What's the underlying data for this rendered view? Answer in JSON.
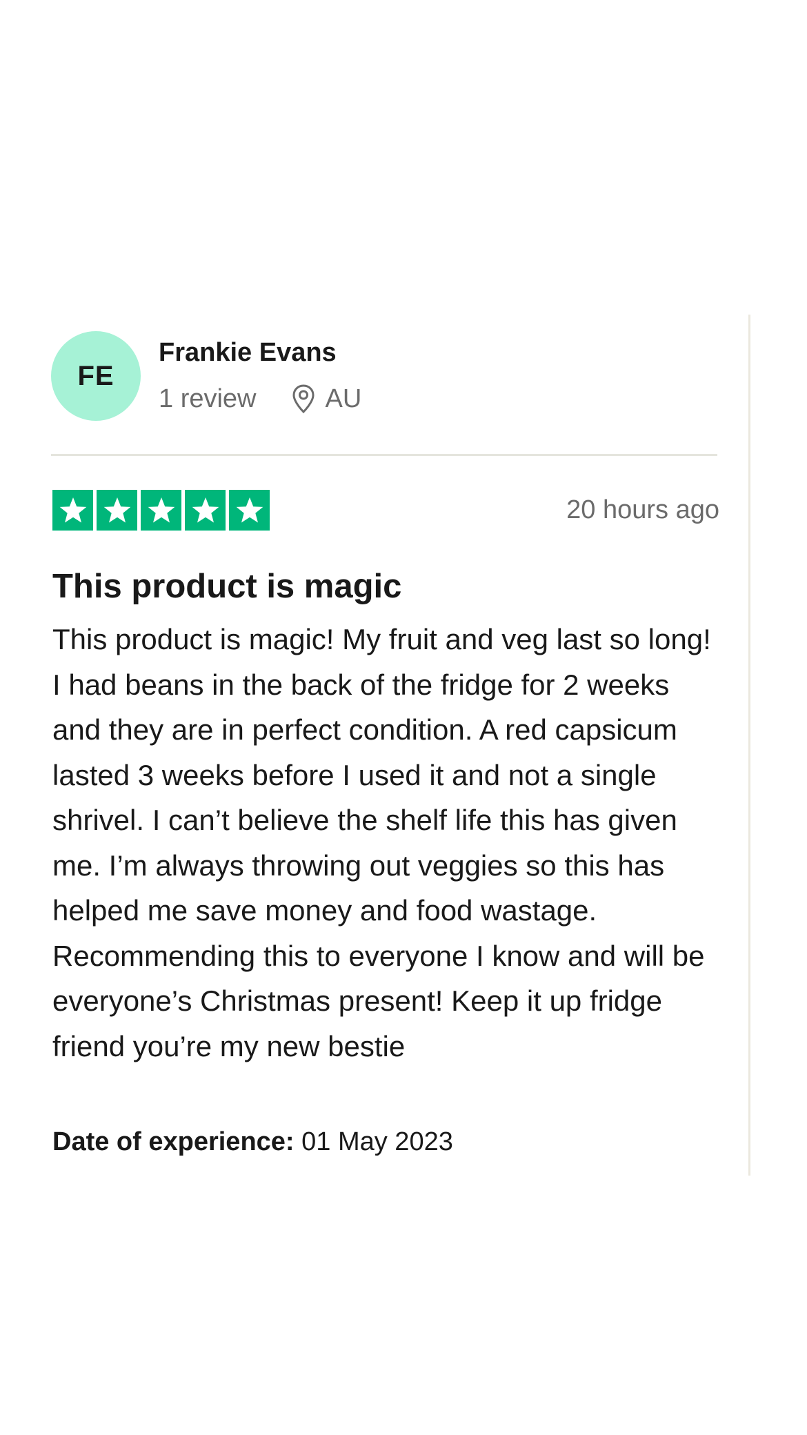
{
  "reviewer": {
    "initials": "FE",
    "name": "Frankie Evans",
    "review_count": "1 review",
    "location_icon": "location-pin-icon",
    "country": "AU",
    "avatar_color": "#a6f2d6"
  },
  "review": {
    "rating": 5,
    "rating_max": 5,
    "star_color": "#00b67a",
    "time_ago": "20 hours ago",
    "title": "This product is magic",
    "body": "This product is magic! My fruit and veg last so long! I had beans in the back of the fridge for 2 weeks and they are in perfect condition. A red capsicum lasted 3 weeks before I used it and not a single shrivel. I can’t believe the shelf life this has given me. I’m always throwing out veggies so this has helped me save money and food wastage. Recommending this to everyone I know and will be everyone’s Christmas present! Keep it up fridge friend you’re my new bestie",
    "experience_label": "Date of experience:",
    "experience_date": "01 May 2023"
  }
}
